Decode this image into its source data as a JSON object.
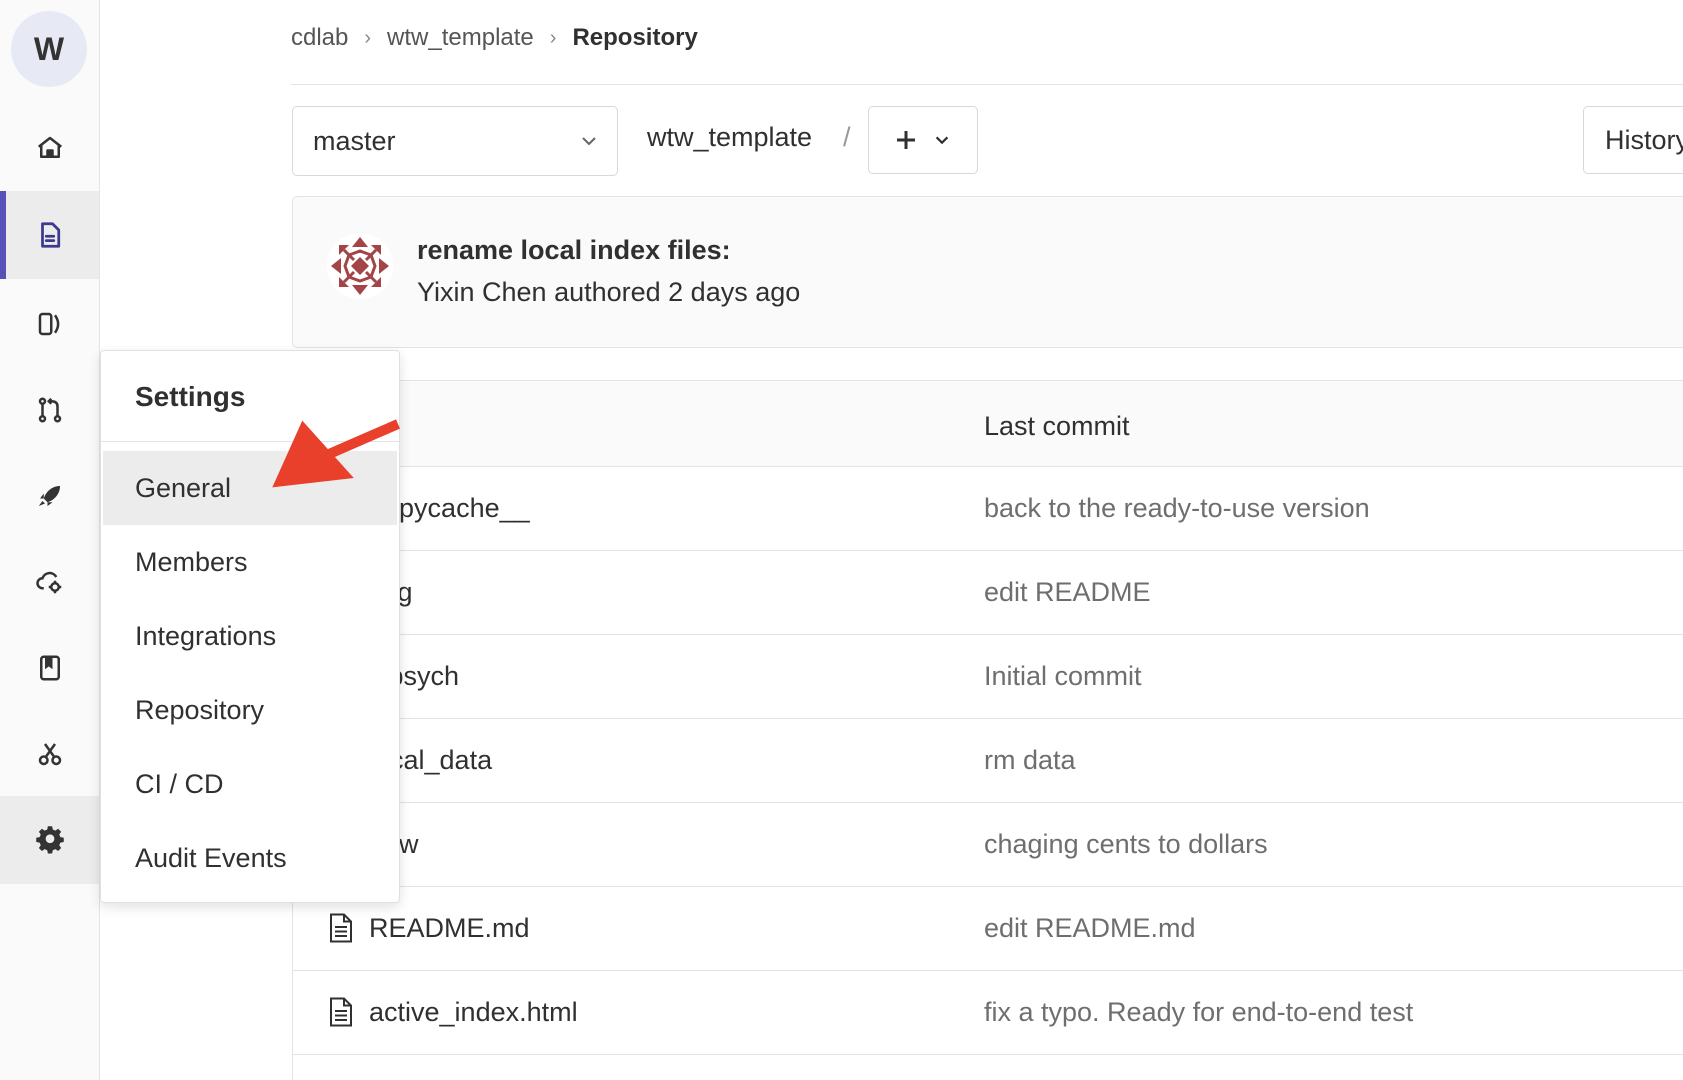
{
  "rail": {
    "avatar_letter": "W",
    "items": [
      {
        "icon": "home-icon"
      },
      {
        "icon": "repository-icon"
      },
      {
        "icon": "issues-icon"
      },
      {
        "icon": "merge-request-icon"
      },
      {
        "icon": "deploy-rocket-icon"
      },
      {
        "icon": "operations-icon"
      },
      {
        "icon": "wiki-icon"
      },
      {
        "icon": "snippets-icon"
      },
      {
        "icon": "settings-gear-icon"
      }
    ],
    "accent_color": "#5651b8"
  },
  "breadcrumb": {
    "items": [
      "cdlab",
      "wtw_template",
      "Repository"
    ],
    "separator": "›"
  },
  "ref_bar": {
    "branch": "master",
    "path": "wtw_template",
    "path_separator": "/",
    "add_label": "+",
    "history_label": "History"
  },
  "last_commit": {
    "title": "rename local index files:",
    "meta": "Yixin Chen authored 2 days ago"
  },
  "file_table": {
    "header_last_commit": "Last commit",
    "rows": [
      {
        "name": "__pycache__",
        "commit": "back to the ready-to-use version"
      },
      {
        "name": "img",
        "commit": "edit README"
      },
      {
        "name": "jspsych",
        "commit": "Initial commit"
      },
      {
        "name": "local_data",
        "commit": "rm data"
      },
      {
        "name": "new",
        "commit": "chaging cents to dollars"
      },
      {
        "name": "README.md",
        "commit": "edit README.md"
      },
      {
        "name": "active_index.html",
        "commit": "fix a typo. Ready for end-to-end test"
      }
    ]
  },
  "settings_flyout": {
    "title": "Settings",
    "items": [
      "General",
      "Members",
      "Integrations",
      "Repository",
      "CI / CD",
      "Audit Events"
    ]
  },
  "annotation": {
    "arrow_color": "#e8402a"
  }
}
